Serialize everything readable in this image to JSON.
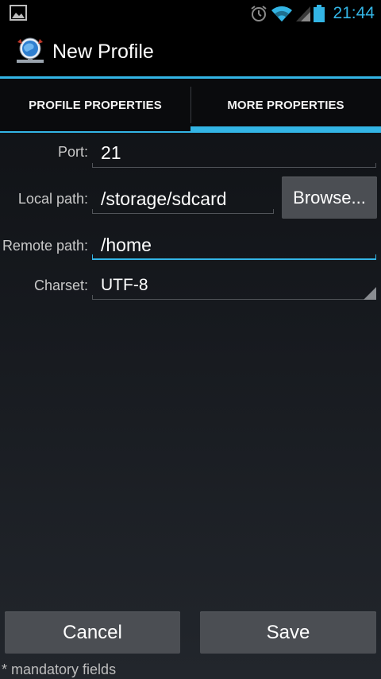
{
  "status_bar": {
    "time": "21:44",
    "icons": [
      "gallery-icon",
      "alarm-icon",
      "wifi-icon",
      "signal-icon",
      "battery-icon"
    ],
    "accent": "#33b5e5"
  },
  "action_bar": {
    "title": "New Profile",
    "app_icon": "globe-network-icon"
  },
  "tabs": [
    {
      "label": "PROFILE PROPERTIES",
      "active": false
    },
    {
      "label": "MORE PROPERTIES",
      "active": true
    }
  ],
  "form": {
    "port": {
      "label": "Port:",
      "value": "21"
    },
    "local_path": {
      "label": "Local path:",
      "value": "/storage/sdcard",
      "browse_label": "Browse..."
    },
    "remote_path": {
      "label": "Remote path:",
      "value": "/home",
      "focused": true
    },
    "charset": {
      "label": "Charset:",
      "selected": "UTF-8"
    }
  },
  "buttons": {
    "cancel": "Cancel",
    "save": "Save"
  },
  "footnote": "* mandatory fields",
  "colors": {
    "accent": "#33b5e5",
    "button_bg": "#4b4e53"
  }
}
